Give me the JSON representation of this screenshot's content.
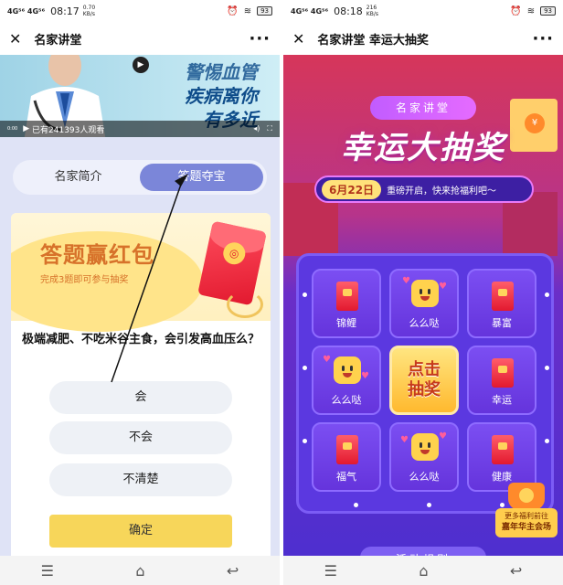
{
  "left": {
    "status": {
      "sig": "4G⁵⁶ 4G⁵⁶",
      "time": "08:17",
      "speed": "0.70 KB/s",
      "battery": "93"
    },
    "nav": {
      "close": "✕",
      "title": "名家讲堂",
      "more": "···"
    },
    "video": {
      "title_line1": "警惕血管",
      "title_line2": "疾病离你",
      "title_line3": "有多近",
      "viewers": "已有241393人观看",
      "elapsed": "0:00",
      "play": "▶"
    },
    "tabs": [
      "名家简介",
      "答题夺宝"
    ],
    "banner": {
      "title": "答题赢红包",
      "subtitle": "完成3题即可参与抽奖"
    },
    "question": "极端减肥、不吃米谷主食，会引发高血压么？",
    "options": [
      "会",
      "不会",
      "不清楚"
    ],
    "confirm": "确定"
  },
  "right": {
    "status": {
      "sig": "4G⁵⁶ 4G⁵⁶",
      "time": "08:18",
      "speed": "216 KB/s",
      "battery": "93"
    },
    "nav": {
      "close": "✕",
      "title": "名家讲堂 幸运大抽奖",
      "more": "···"
    },
    "tag": "名家讲堂",
    "title": "幸运大抽奖",
    "date": "6月22日",
    "date_text": "重磅开启，快来抢福利吧～",
    "prizes": [
      "锦鲤",
      "么么哒",
      "暴富",
      "么么哒",
      "幸运",
      "福气",
      "么么哒",
      "健康"
    ],
    "center_line1": "点击",
    "center_line2": "抽奖",
    "promo_line1": "更多福利前往",
    "promo_line2": "嘉年华主会场",
    "bottom_button": "活动规则"
  },
  "sysnav": [
    "☰",
    "⌂",
    "↩"
  ],
  "colors": {
    "tab_active": "#7b86d9",
    "confirm": "#f7d65a",
    "board": "#5b38e0",
    "accent_pink": "#e879f9"
  }
}
